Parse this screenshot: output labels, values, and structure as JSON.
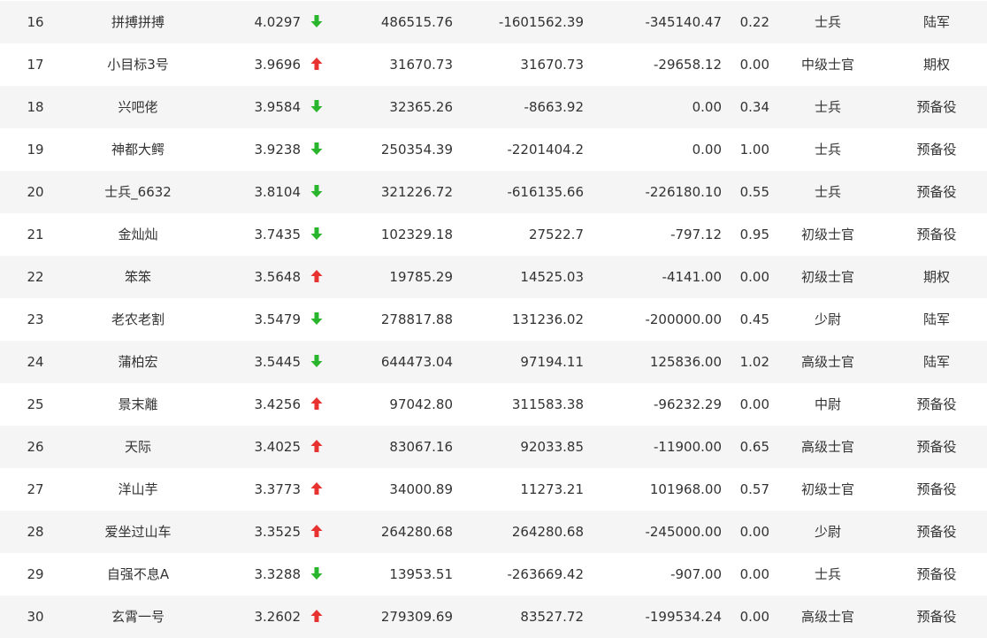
{
  "colors": {
    "up": "#e8322f",
    "down": "#2ab52f",
    "text": "#333333",
    "row_alt_bg": "#f5f5f5"
  },
  "rows": [
    {
      "rank": "16",
      "name": "拼搏拼搏",
      "score": "4.0297",
      "trend": "down",
      "v1": "486515.76",
      "v2": "-1601562.39",
      "v3": "-345140.47",
      "ratio": "0.22",
      "level": "士兵",
      "group": "陆军"
    },
    {
      "rank": "17",
      "name": "小目标3号",
      "score": "3.9696",
      "trend": "up",
      "v1": "31670.73",
      "v2": "31670.73",
      "v3": "-29658.12",
      "ratio": "0.00",
      "level": "中级士官",
      "group": "期权"
    },
    {
      "rank": "18",
      "name": "兴吧佬",
      "score": "3.9584",
      "trend": "down",
      "v1": "32365.26",
      "v2": "-8663.92",
      "v3": "0.00",
      "ratio": "0.34",
      "level": "士兵",
      "group": "预备役"
    },
    {
      "rank": "19",
      "name": "神都大鳄",
      "score": "3.9238",
      "trend": "down",
      "v1": "250354.39",
      "v2": "-2201404.2",
      "v3": "0.00",
      "ratio": "1.00",
      "level": "士兵",
      "group": "预备役"
    },
    {
      "rank": "20",
      "name": "士兵_6632",
      "score": "3.8104",
      "trend": "down",
      "v1": "321226.72",
      "v2": "-616135.66",
      "v3": "-226180.10",
      "ratio": "0.55",
      "level": "士兵",
      "group": "预备役"
    },
    {
      "rank": "21",
      "name": "金灿灿",
      "score": "3.7435",
      "trend": "down",
      "v1": "102329.18",
      "v2": "27522.7",
      "v3": "-797.12",
      "ratio": "0.95",
      "level": "初级士官",
      "group": "预备役"
    },
    {
      "rank": "22",
      "name": "笨笨",
      "score": "3.5648",
      "trend": "up",
      "v1": "19785.29",
      "v2": "14525.03",
      "v3": "-4141.00",
      "ratio": "0.00",
      "level": "初级士官",
      "group": "期权"
    },
    {
      "rank": "23",
      "name": "老农老割",
      "score": "3.5479",
      "trend": "down",
      "v1": "278817.88",
      "v2": "131236.02",
      "v3": "-200000.00",
      "ratio": "0.45",
      "level": "少尉",
      "group": "陆军"
    },
    {
      "rank": "24",
      "name": "蒲柏宏",
      "score": "3.5445",
      "trend": "down",
      "v1": "644473.04",
      "v2": "97194.11",
      "v3": "125836.00",
      "ratio": "1.02",
      "level": "高级士官",
      "group": "陆军"
    },
    {
      "rank": "25",
      "name": "景末離",
      "score": "3.4256",
      "trend": "up",
      "v1": "97042.80",
      "v2": "311583.38",
      "v3": "-96232.29",
      "ratio": "0.00",
      "level": "中尉",
      "group": "预备役"
    },
    {
      "rank": "26",
      "name": "天际",
      "score": "3.4025",
      "trend": "up",
      "v1": "83067.16",
      "v2": "92033.85",
      "v3": "-11900.00",
      "ratio": "0.65",
      "level": "高级士官",
      "group": "预备役"
    },
    {
      "rank": "27",
      "name": "洋山芋",
      "score": "3.3773",
      "trend": "up",
      "v1": "34000.89",
      "v2": "11273.21",
      "v3": "101968.00",
      "ratio": "0.57",
      "level": "初级士官",
      "group": "预备役"
    },
    {
      "rank": "28",
      "name": "爱坐过山车",
      "score": "3.3525",
      "trend": "up",
      "v1": "264280.68",
      "v2": "264280.68",
      "v3": "-245000.00",
      "ratio": "0.00",
      "level": "少尉",
      "group": "预备役"
    },
    {
      "rank": "29",
      "name": "自强不息A",
      "score": "3.3288",
      "trend": "down",
      "v1": "13953.51",
      "v2": "-263669.42",
      "v3": "-907.00",
      "ratio": "0.00",
      "level": "士兵",
      "group": "预备役"
    },
    {
      "rank": "30",
      "name": "玄霄一号",
      "score": "3.2602",
      "trend": "up",
      "v1": "279309.69",
      "v2": "83527.72",
      "v3": "-199534.24",
      "ratio": "0.00",
      "level": "高级士官",
      "group": "预备役"
    }
  ]
}
